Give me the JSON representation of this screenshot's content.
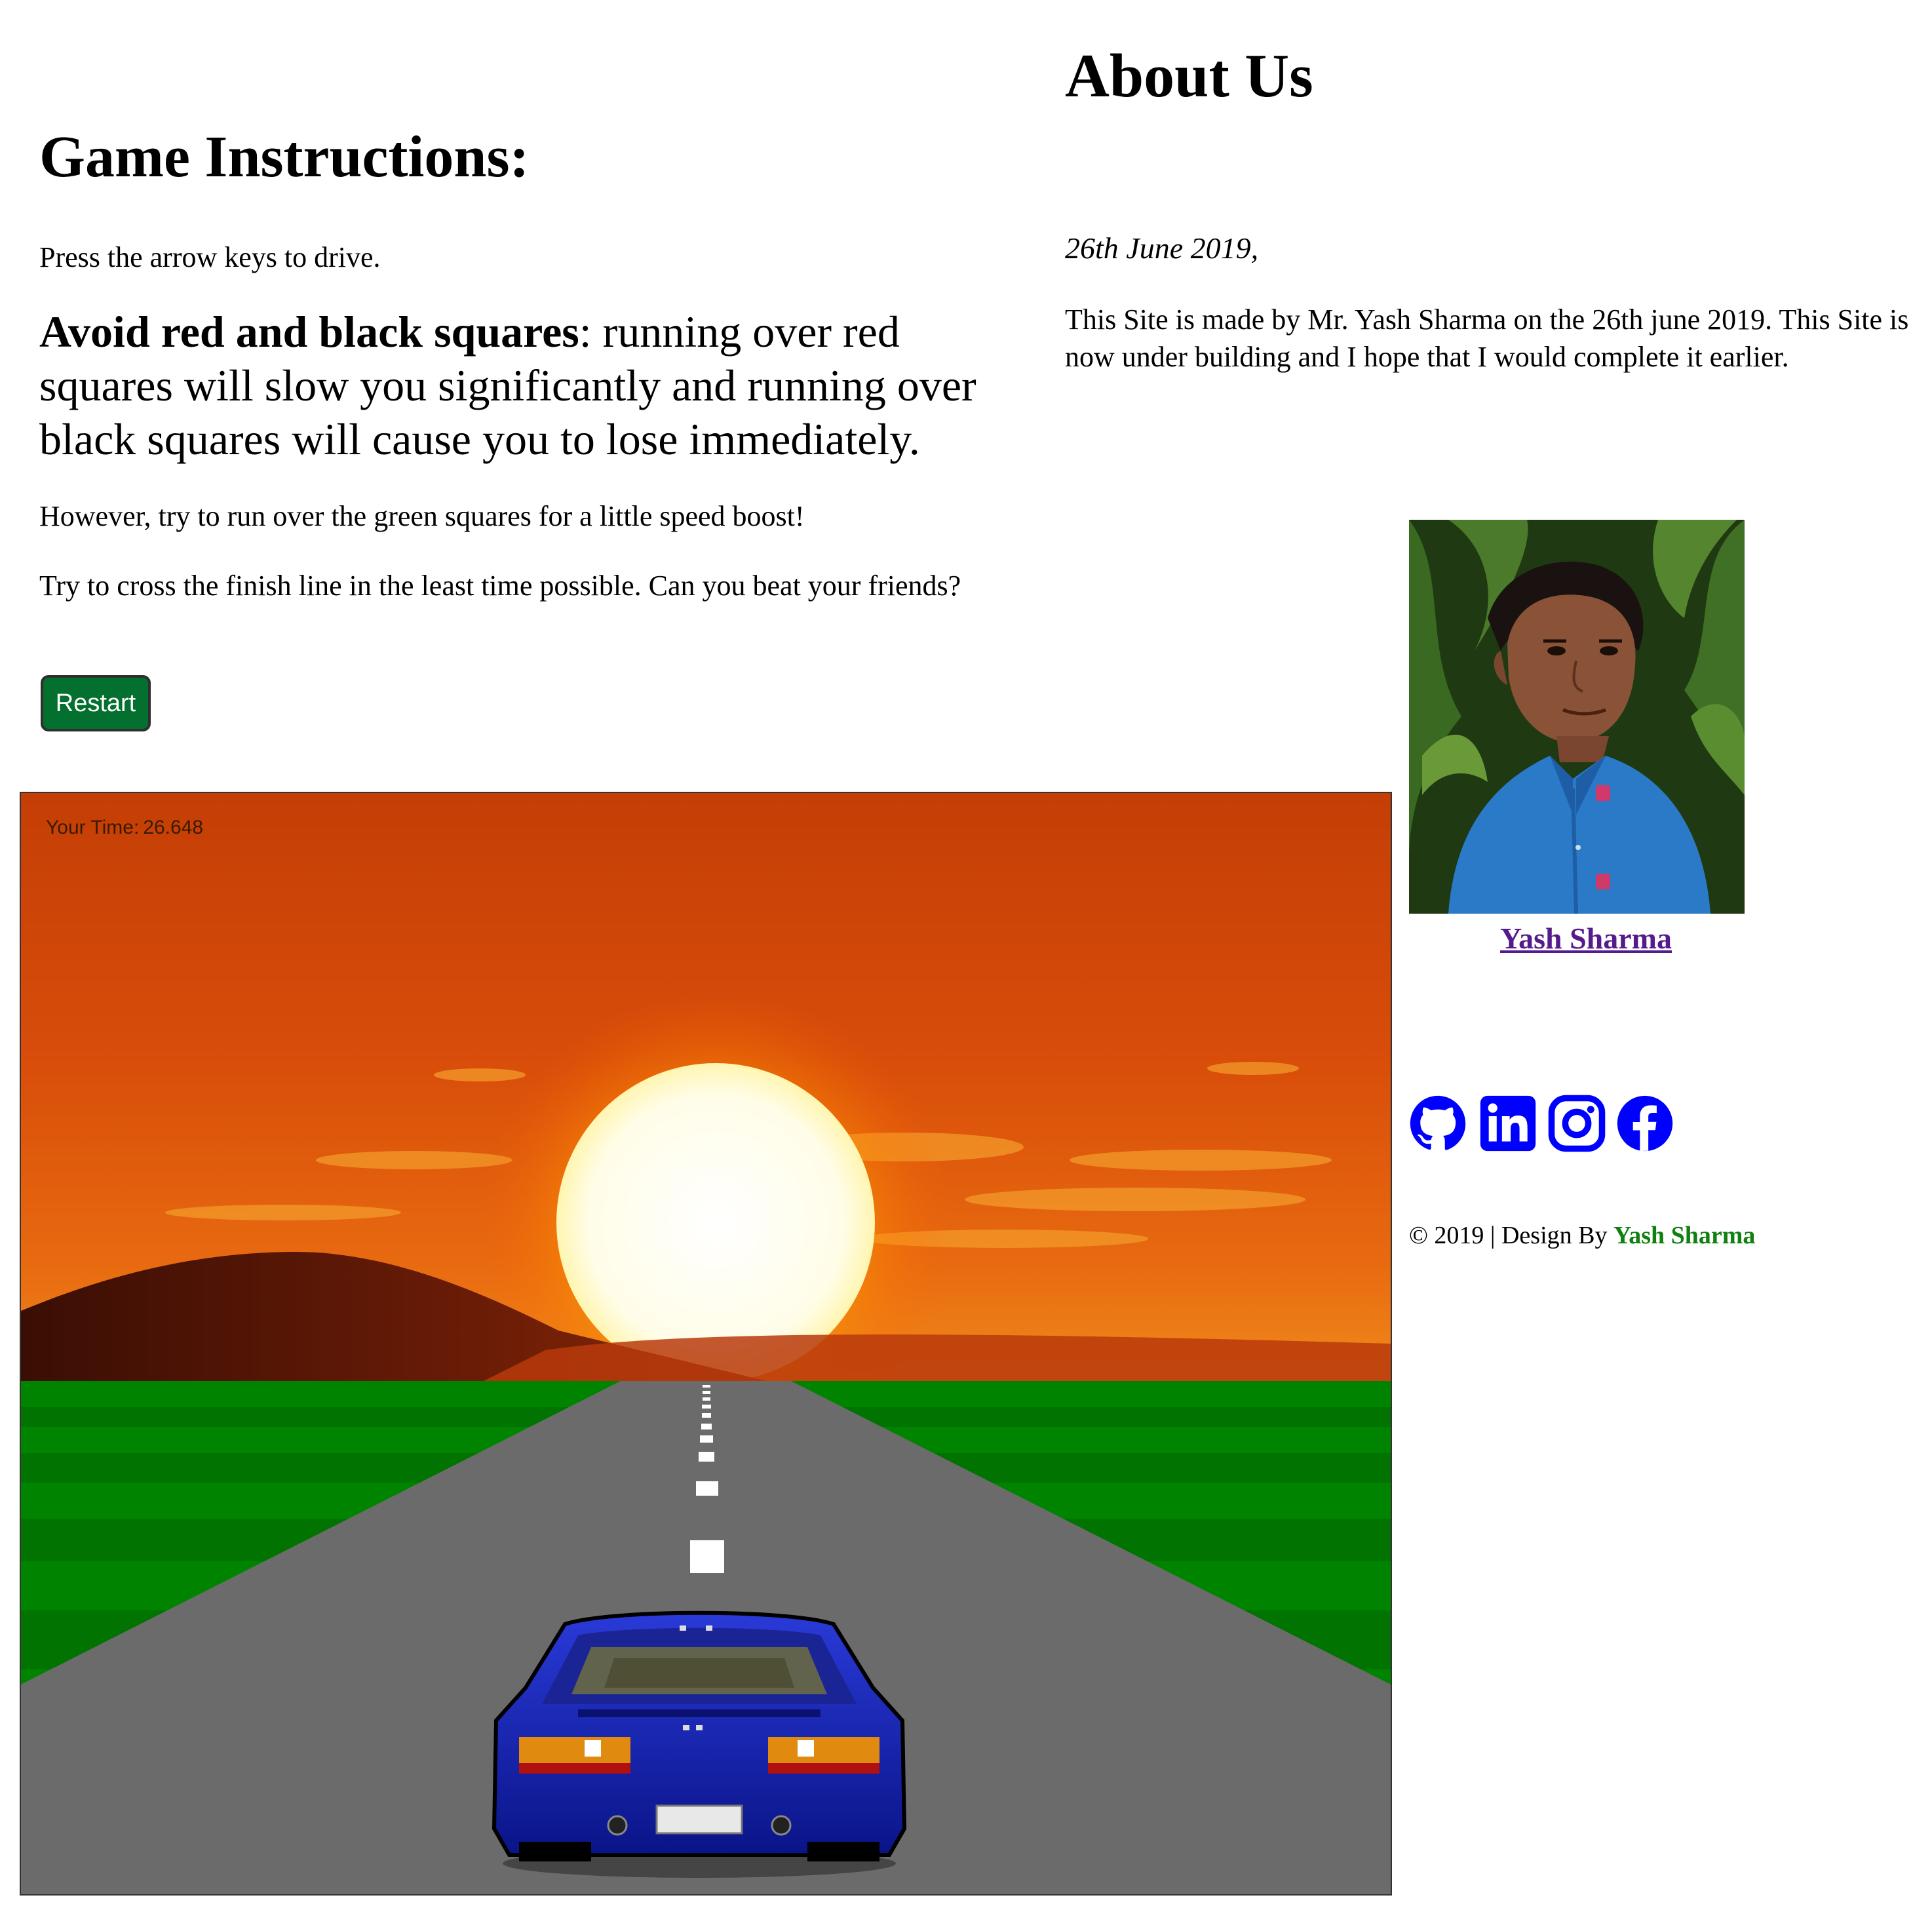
{
  "instructions": {
    "heading": "Game Instructions:",
    "line1": "Press the arrow keys to drive.",
    "avoid_bold": "Avoid red and black squares",
    "avoid_rest": ": running over red squares will slow you significantly and running over black squares will cause you to lose immediately.",
    "line3": "However, try to run over the green squares for a little speed boost!",
    "line4": "Try to cross the finish line in the least time possible. Can you beat your friends?",
    "restart_label": "Restart"
  },
  "game": {
    "timer_label": "Your Time:",
    "timer_value": "26.648"
  },
  "about": {
    "heading": "About Us",
    "date": "26th June 2019,",
    "text": "This Site is made by Mr. Yash Sharma on the 26th june 2019. This Site is now under building and I hope that I would complete it earlier.",
    "profile_name": "Yash Sharma"
  },
  "social": {
    "icons": [
      "github-icon",
      "linkedin-icon",
      "instagram-icon",
      "facebook-icon"
    ],
    "color": "#0000ff"
  },
  "footer": {
    "prefix": "© 2019 | Design By",
    "author": "Yash Sharma",
    "author_color": "#108010"
  },
  "colors": {
    "restart_bg": "#03702f",
    "link_visited": "#551a8b"
  }
}
